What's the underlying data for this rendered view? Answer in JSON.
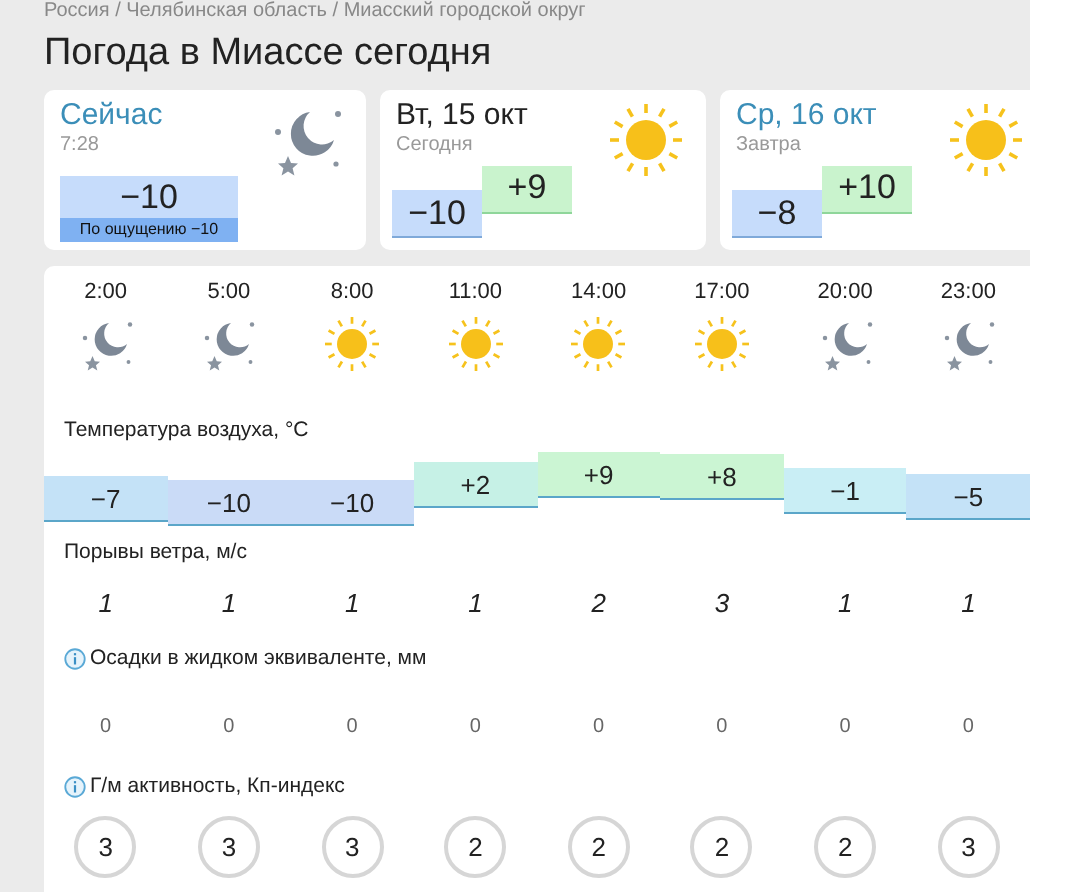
{
  "breadcrumb": "Россия / Челябинская область / Миасский городской округ",
  "title": "Погода в Миассе сегодня",
  "cards": [
    {
      "title": "Сейчас",
      "subtitle": "7:28",
      "link": true,
      "kind": "now",
      "temp": "−10",
      "feels": "По ощущению −10"
    },
    {
      "title": "Вт, 15 окт",
      "subtitle": "Сегодня",
      "link": false,
      "kind": "day",
      "min": "−10",
      "max": "+9"
    },
    {
      "title": "Ср, 16 окт",
      "subtitle": "Завтра",
      "link": true,
      "kind": "day",
      "min": "−8",
      "max": "+10"
    }
  ],
  "hours": [
    {
      "time": "2:00",
      "kind": "night",
      "temp": "−7",
      "color": "#c4e2f7",
      "gust": "1",
      "precip": "0",
      "kp": "3"
    },
    {
      "time": "5:00",
      "kind": "night",
      "temp": "−10",
      "color": "#cadbf7",
      "gust": "1",
      "precip": "0",
      "kp": "3"
    },
    {
      "time": "8:00",
      "kind": "sun",
      "temp": "−10",
      "color": "#cadbf7",
      "gust": "1",
      "precip": "0",
      "kp": "3"
    },
    {
      "time": "11:00",
      "kind": "sun",
      "temp": "+2",
      "color": "#c6f1e6",
      "gust": "1",
      "precip": "0",
      "kp": "2"
    },
    {
      "time": "14:00",
      "kind": "sun",
      "temp": "+9",
      "color": "#cbf5d3",
      "gust": "2",
      "precip": "0",
      "kp": "2"
    },
    {
      "time": "17:00",
      "kind": "sun",
      "temp": "+8",
      "color": "#cbf5d3",
      "gust": "3",
      "precip": "0",
      "kp": "2"
    },
    {
      "time": "20:00",
      "kind": "night",
      "temp": "−1",
      "color": "#c9eef5",
      "gust": "1",
      "precip": "0",
      "kp": "2"
    },
    {
      "time": "23:00",
      "kind": "night",
      "temp": "−5",
      "color": "#c4e2f7",
      "gust": "1",
      "precip": "0",
      "kp": "3"
    }
  ],
  "sections": {
    "temp": "Температура воздуха, °C",
    "gust": "Порывы ветра, м/с",
    "precip": "Осадки в жидком эквиваленте, мм",
    "kp": "Г/м активность, Кп-индекс"
  }
}
